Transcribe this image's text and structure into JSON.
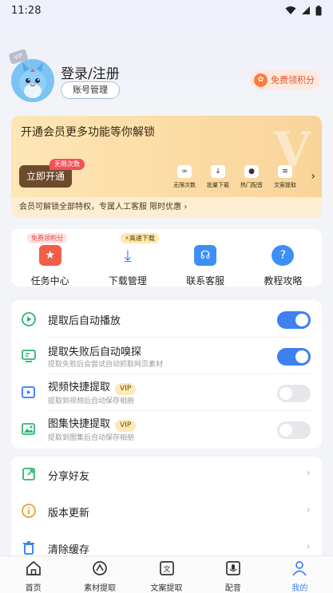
{
  "status_bar": {
    "time": "11:28"
  },
  "profile": {
    "vip_badge": "VIP",
    "login_text": "登录/注册",
    "account_button": "账号管理",
    "points_button": "免费领积分"
  },
  "vip_card": {
    "title": "开通会员更多功能等你解锁",
    "watermark": "V",
    "open_button": "立即开通",
    "open_tag": "无限次数",
    "benefits": [
      {
        "icon": "infinity-icon",
        "label": "无限次数"
      },
      {
        "icon": "download-icon",
        "label": "批量下载"
      },
      {
        "icon": "microphone-icon",
        "label": "热门配音"
      },
      {
        "icon": "text-icon",
        "label": "文案提取"
      }
    ],
    "footer_text": "会员可解锁全部特权，专属人工客服 限时优惠"
  },
  "tools": [
    {
      "label": "任务中心",
      "tag": "免费领积分",
      "icon": "task-gift-icon"
    },
    {
      "label": "下载管理",
      "tag": "⚡高速下载",
      "icon": "download-tray-icon"
    },
    {
      "label": "联系客服",
      "tag": "",
      "icon": "headset-icon"
    },
    {
      "label": "教程攻略",
      "tag": "",
      "icon": "help-icon"
    }
  ],
  "settings": [
    {
      "title": "提取后自动播放",
      "subtitle": "",
      "vip": "",
      "on": true,
      "icon": "play-circle-icon"
    },
    {
      "title": "提取失败后自动嗅探",
      "subtitle": "提取失败后会尝试自动抓取网页素材",
      "vip": "",
      "on": true,
      "icon": "monitor-icon"
    },
    {
      "title": "视频快捷提取",
      "subtitle": "提取到视频后自动保存相册",
      "vip": "VIP",
      "on": false,
      "icon": "video-save-icon"
    },
    {
      "title": "图集快捷提取",
      "subtitle": "提取到图集后自动保存相册",
      "vip": "VIP",
      "on": false,
      "icon": "image-save-icon"
    }
  ],
  "menu": [
    {
      "label": "分享好友",
      "icon": "share-icon"
    },
    {
      "label": "版本更新",
      "icon": "info-icon"
    },
    {
      "label": "清除缓存",
      "icon": "trash-icon"
    }
  ],
  "bottom_nav": [
    {
      "label": "首页",
      "icon": "home-icon",
      "active": false
    },
    {
      "label": "素材提取",
      "icon": "material-icon",
      "active": false
    },
    {
      "label": "文案提取",
      "icon": "text-box-icon",
      "active": false
    },
    {
      "label": "配音",
      "icon": "voice-icon",
      "active": false
    },
    {
      "label": "我的",
      "icon": "person-icon",
      "active": true
    }
  ],
  "colors": {
    "accent": "#3e80ef",
    "toggle_off": "#e6e7ea",
    "vip_gold": "#fbdba3",
    "green_icon": "#2bb673"
  }
}
